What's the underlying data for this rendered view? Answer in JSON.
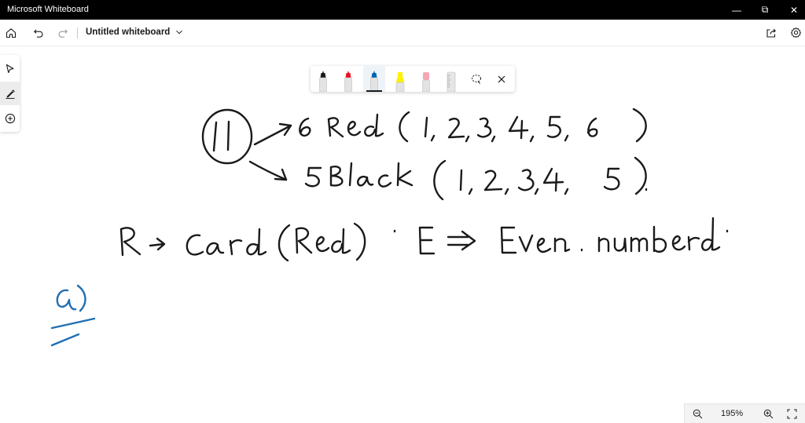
{
  "window": {
    "title": "Microsoft Whiteboard",
    "controls": {
      "minimize": "—",
      "maximize": "⧉",
      "close": "✕"
    }
  },
  "appbar": {
    "board_title": "Untitled whiteboard",
    "icons": [
      "home-icon",
      "undo-icon",
      "redo-icon",
      "chevron-down-icon",
      "share-icon",
      "settings-icon"
    ]
  },
  "side_tools": [
    "select-icon",
    "inking-icon",
    "add-icon"
  ],
  "pen_toolbar": {
    "pens": [
      {
        "name": "black-pen",
        "color": "#1a1a1a"
      },
      {
        "name": "red-pen",
        "color": "#e81123"
      },
      {
        "name": "blue-pen",
        "color": "#0063b1",
        "selected": true
      },
      {
        "name": "yellow-highlighter",
        "color": "#fff100"
      },
      {
        "name": "pink-eraser",
        "color": "#f3a6b6"
      },
      {
        "name": "ruler",
        "color": "#d8d8d8"
      }
    ],
    "tools": [
      "lasso-icon",
      "close-icon"
    ]
  },
  "ink": {
    "black": "#1a1a1a",
    "blue": "#1f6fb2"
  },
  "zoom": {
    "level": "195%",
    "icons": [
      "zoom-out-icon",
      "zoom-in-icon",
      "fit-to-screen-icon"
    ]
  }
}
